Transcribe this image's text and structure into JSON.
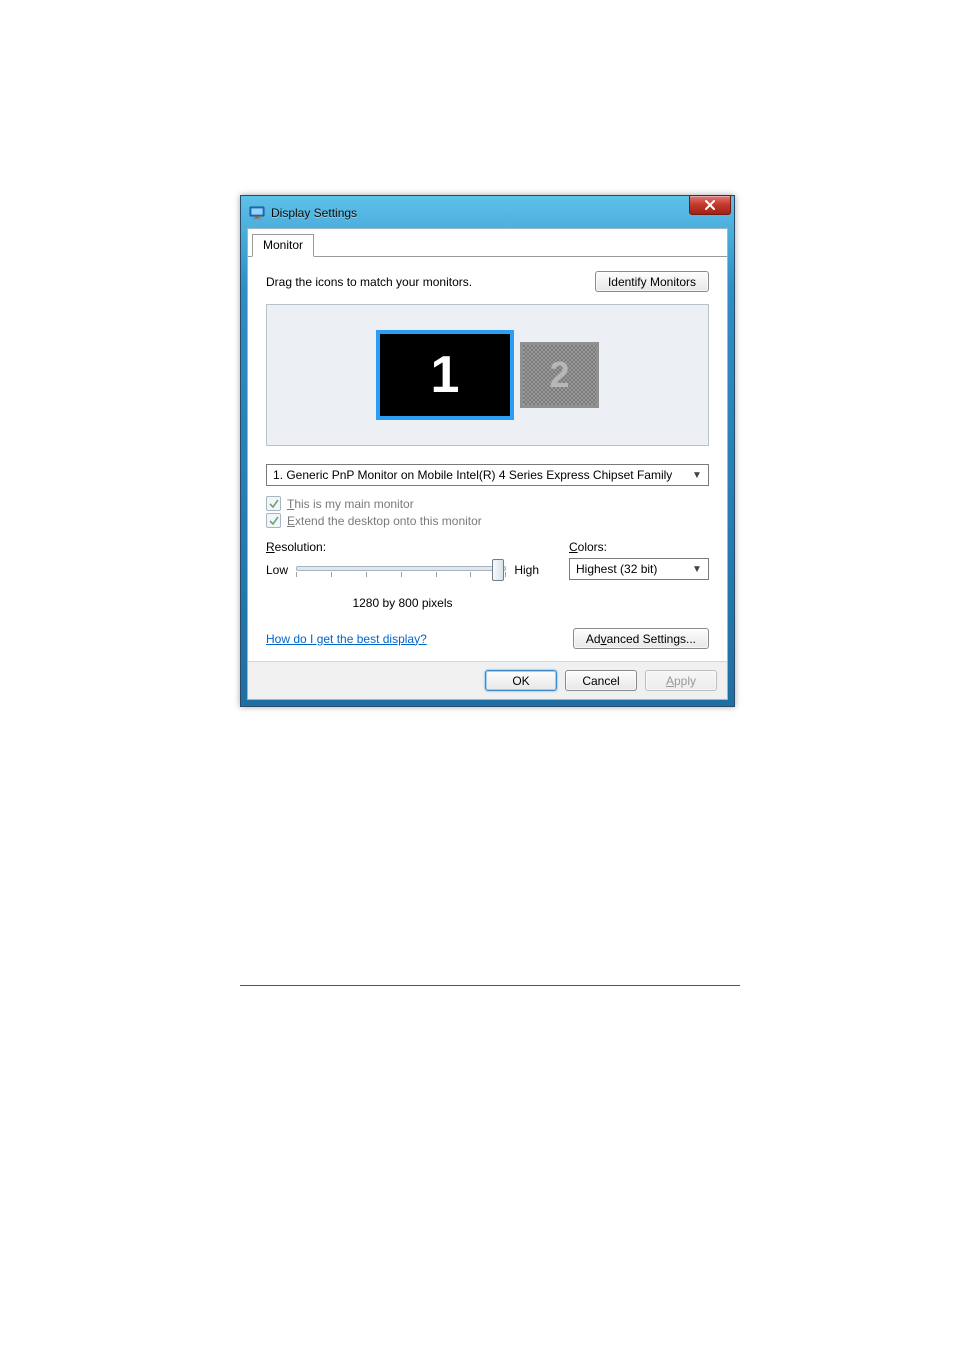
{
  "window": {
    "title": "Display Settings",
    "close_tooltip": "Close"
  },
  "tabs": [
    {
      "label": "Monitor"
    }
  ],
  "instructions": "Drag the icons to match your monitors.",
  "identify_button": "Identify Monitors",
  "monitors": {
    "primary_number": "1",
    "secondary_number": "2"
  },
  "monitor_dropdown": {
    "selected": "1. Generic PnP Monitor on Mobile Intel(R) 4 Series Express Chipset Family"
  },
  "checkboxes": {
    "main_monitor": {
      "label_pre": "",
      "label_ul": "T",
      "label_post": "his is my main monitor",
      "checked": true,
      "disabled": true
    },
    "extend": {
      "label_pre": "",
      "label_ul": "E",
      "label_post": "xtend the desktop onto this monitor",
      "checked": true,
      "disabled": true
    }
  },
  "resolution": {
    "label_ul": "R",
    "label_post": "esolution:",
    "low": "Low",
    "high": "High",
    "value_text": "1280 by 800 pixels",
    "thumb_percent": 96
  },
  "colors": {
    "label_ul": "C",
    "label_post": "olors:",
    "selected": "Highest (32 bit)"
  },
  "help_link": "How do I get the best display?",
  "advanced_button_pre": "Ad",
  "advanced_button_ul": "v",
  "advanced_button_post": "anced Settings...",
  "buttons": {
    "ok": "OK",
    "cancel": "Cancel",
    "apply_ul": "A",
    "apply_post": "pply"
  }
}
